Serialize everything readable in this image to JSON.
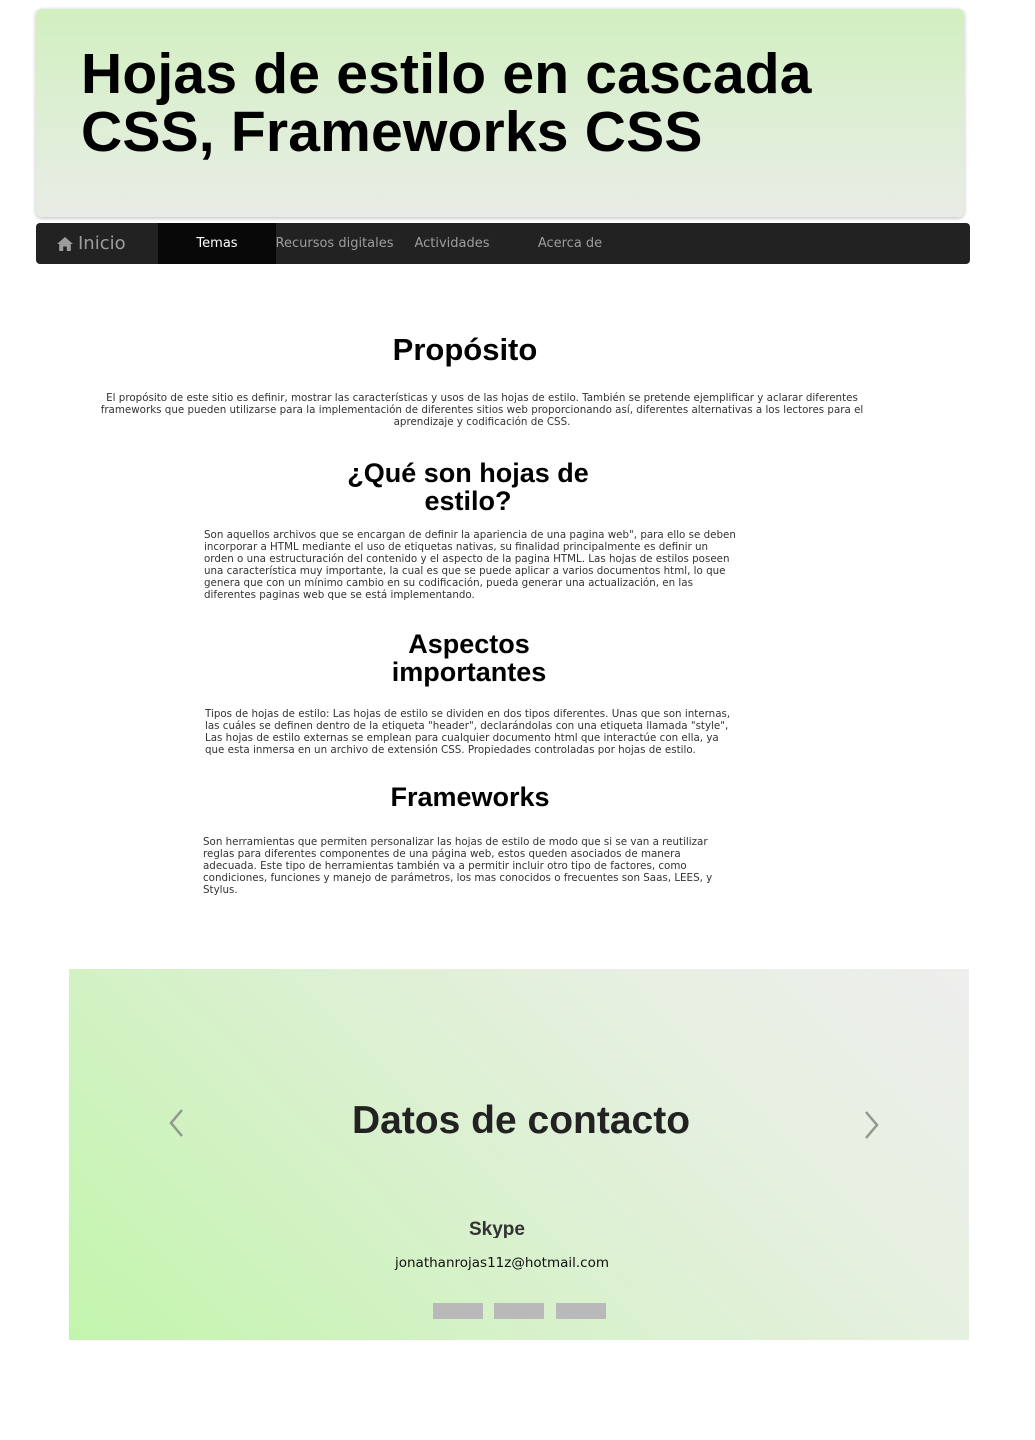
{
  "header": {
    "title": "Hojas de estilo en cascada CSS, Frameworks CSS"
  },
  "navbar": {
    "brand_icon": "home-icon",
    "brand_label": "Inicio",
    "items": [
      {
        "label": "Temas",
        "active": true
      },
      {
        "label": "Recursos digitales",
        "active": false
      },
      {
        "label": "Actividades",
        "active": false
      },
      {
        "label": "Acerca de",
        "active": false
      }
    ]
  },
  "sections": [
    {
      "heading": "Propósito",
      "text": "El propósito de este sitio es definir, mostrar las características y usos de las hojas de estilo. También se pretende ejemplificar y aclarar diferentes frameworks que pueden utilizarse para la implementación de diferentes sitios web proporcionando así, diferentes alternativas a los lectores para el aprendizaje y codificación de CSS."
    },
    {
      "heading": "¿Qué son hojas de estilo?",
      "text": "Son aquellos archivos que se encargan de definir la apariencia de una pagina web\", para ello se deben incorporar a HTML mediante el uso de etiquetas nativas, su finalidad principalmente es definir un orden o una estructuración del contenido y el aspecto de la pagina HTML. Las hojas de estilos poseen una característica muy importante, la cual es que se puede aplicar a varios documentos html, lo que genera que con un mínimo cambio en su codificación, pueda generar una actualización, en las diferentes paginas web que se está implementando."
    },
    {
      "heading": "Aspectos importantes",
      "text": "Tipos de hojas de estilo: Las hojas de estilo se dividen en dos tipos diferentes. Unas que son internas, las cuáles se definen dentro de la etiqueta \"header\", declarándolas con una etiqueta llamada \"style\", Las hojas de estilo externas se emplean para cualquier documento html que interactúe con ella, ya que esta inmersa en un archivo de extensión CSS. Propiedades controladas por hojas de estilo."
    },
    {
      "heading": "Frameworks",
      "text": "Son herramientas que permiten personalizar las hojas de estilo de modo que si se van a reutilizar reglas para diferentes componentes  de una página web, estos queden asociados de manera adecuada. Este tipo de herramientas también va a permitir incluir otro tipo de factores, como condiciones, funciones y manejo de parámetros, los mas conocidos o frecuentes son Saas, LEES, y Stylus."
    }
  ],
  "contact": {
    "title": "Datos de contacto",
    "label": "Skype",
    "email": "jonathanrojas11z@hotmail.com",
    "prev_icon": "chevron-left-icon",
    "next_icon": "chevron-right-icon",
    "indicator_count": 3
  }
}
